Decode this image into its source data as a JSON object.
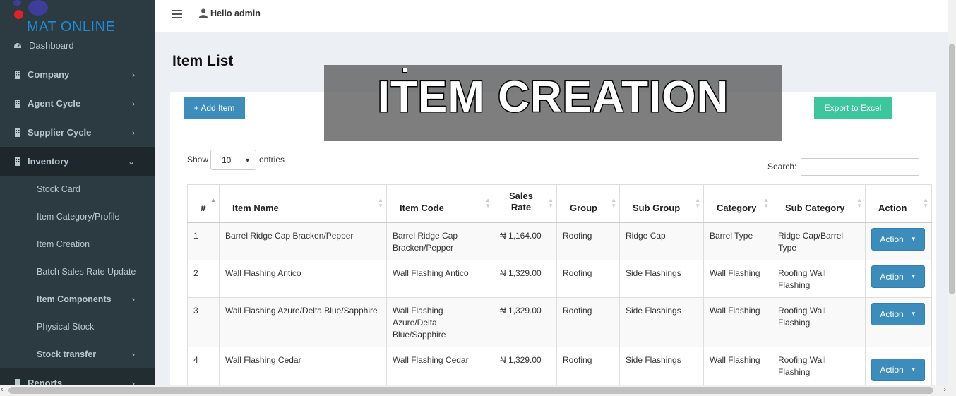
{
  "app": {
    "logo_text": "MAT ONLINE",
    "greeting": "Hello admin"
  },
  "sidebar": {
    "items": [
      {
        "label": "Dashboard",
        "icon": "dashboard-icon",
        "chevron": ""
      },
      {
        "label": "Company",
        "icon": "building-icon",
        "chevron": "›"
      },
      {
        "label": "Agent Cycle",
        "icon": "building-icon",
        "chevron": "›"
      },
      {
        "label": "Supplier Cycle",
        "icon": "building-icon",
        "chevron": "›"
      },
      {
        "label": "Inventory",
        "icon": "building-icon",
        "chevron": "⌄"
      },
      {
        "label": "Reports",
        "icon": "building-icon",
        "chevron": "›"
      }
    ],
    "inventory_sub": [
      {
        "label": "Stock Card",
        "chevron": ""
      },
      {
        "label": "Item Category/Profile",
        "chevron": ""
      },
      {
        "label": "Item Creation",
        "chevron": ""
      },
      {
        "label": "Batch Sales Rate Update",
        "chevron": ""
      },
      {
        "label": "Item Components",
        "chevron": "›"
      },
      {
        "label": "Physical Stock",
        "chevron": ""
      },
      {
        "label": "Stock transfer",
        "chevron": "›"
      }
    ]
  },
  "page": {
    "title": "Item List",
    "add_button": "+ Add Item",
    "export_button": "Export to Excel",
    "show_label": "Show",
    "entries_value": "10",
    "entries_label": "entries",
    "search_label": "Search:",
    "search_value": ""
  },
  "overlay": {
    "text": "ITEM CREATION"
  },
  "table": {
    "headers": [
      "#",
      "Item Name",
      "Item Code",
      "Sales Rate",
      "Group",
      "Sub Group",
      "Category",
      "Sub Category",
      "Action"
    ],
    "action_label": "Action",
    "rows": [
      {
        "num": "1",
        "name": "Barrel Ridge Cap Bracken/Pepper",
        "code": "Barrel Ridge Cap Bracken/Pepper",
        "rate": "₦ 1,164.00",
        "group": "Roofing",
        "subgroup": "Ridge Cap",
        "category": "Barrel Type",
        "subcategory": "Ridge Cap/Barrel Type"
      },
      {
        "num": "2",
        "name": "Wall Flashing Antico",
        "code": "Wall Flashing Antico",
        "rate": "₦ 1,329.00",
        "group": "Roofing",
        "subgroup": "Side Flashings",
        "category": "Wall Flashing",
        "subcategory": "Roofing Wall Flashing"
      },
      {
        "num": "3",
        "name": "Wall Flashing Azure/Delta Blue/Sapphire",
        "code": "Wall Flashing Azure/Delta Blue/Sapphire",
        "rate": "₦ 1,329.00",
        "group": "Roofing",
        "subgroup": "Side Flashings",
        "category": "Wall Flashing",
        "subcategory": "Roofing Wall Flashing"
      },
      {
        "num": "4",
        "name": "Wall Flashing Cedar",
        "code": "Wall Flashing Cedar",
        "rate": "₦ 1,329.00",
        "group": "Roofing",
        "subgroup": "Side Flashings",
        "category": "Wall Flashing",
        "subcategory": "Roofing Wall Flashing"
      }
    ]
  },
  "colors": {
    "sidebar": "#2c3b41",
    "primary": "#3c8dbc",
    "excel": "#3cc69b"
  }
}
